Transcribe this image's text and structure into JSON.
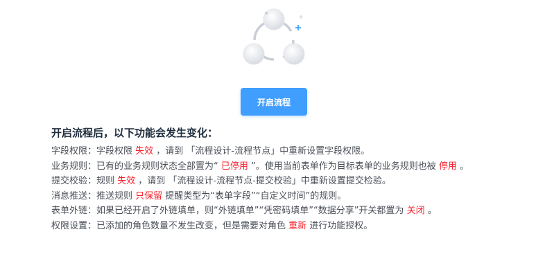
{
  "button_label": "开启流程",
  "title": "开启流程后，以下功能会发生变化：",
  "items": [
    {
      "label": "字段权限：",
      "parts": [
        {
          "t": "字段权限 "
        },
        {
          "t": "失效",
          "hl": true
        },
        {
          "t": " ，请到 「流程设计-流程节点」中重新设置字段权限。"
        }
      ]
    },
    {
      "label": "业务规则：",
      "parts": [
        {
          "t": "已有的业务规则状态全部置为“ "
        },
        {
          "t": "已停用",
          "hl": true
        },
        {
          "t": " ”。使用当前表单作为目标表单的业务规则也被 "
        },
        {
          "t": "停用",
          "hl": true
        },
        {
          "t": " 。"
        }
      ]
    },
    {
      "label": "提交校验：",
      "parts": [
        {
          "t": "规则 "
        },
        {
          "t": "失效",
          "hl": true
        },
        {
          "t": " ，请到 「流程设计-流程节点-提交校验」中重新设置提交检验。"
        }
      ]
    },
    {
      "label": "消息推送：",
      "parts": [
        {
          "t": "推送规则 "
        },
        {
          "t": "只保留",
          "hl": true
        },
        {
          "t": " 提醒类型为“表单字段”“自定义时间”的规则。"
        }
      ]
    },
    {
      "label": "表单外链：",
      "parts": [
        {
          "t": "如果已经开启了外链填单，则“外链填单”“凭密码填单”“数据分享”开关都置为 "
        },
        {
          "t": "关闭",
          "hl": true
        },
        {
          "t": " 。"
        }
      ]
    },
    {
      "label": "权限设置：",
      "parts": [
        {
          "t": "已添加的角色数量不发生改变，但是需要对角色 "
        },
        {
          "t": "重新",
          "hl": true
        },
        {
          "t": " 进行功能授权。"
        }
      ]
    }
  ],
  "colors": {
    "primary": "#409eff",
    "highlight": "#f5222d",
    "text": "#4a4f57",
    "title": "#1f2d3d"
  },
  "icons": {
    "illustration": "workflow-cycle-icon"
  }
}
